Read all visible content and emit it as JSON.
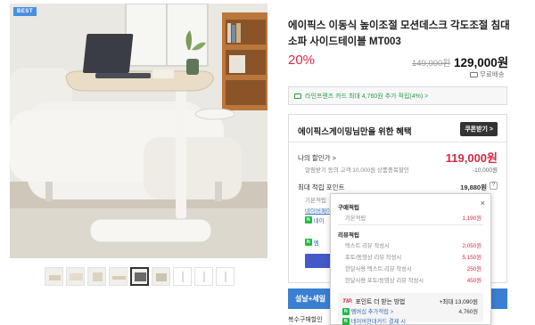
{
  "product": {
    "badge": "BEST",
    "title": "에이픽스 이동식 높이조절 모션데스크 각도조절 침대소파 사이드테이블 MT003",
    "discount": "20%",
    "original_price": "149,000원",
    "price": "129,000원",
    "shipping": "무료배송"
  },
  "thumbnails": {
    "count": 10,
    "active_index": 5
  },
  "card_promo": {
    "text": "라인프렌즈 카드 최대 4,760원 추가 적립(4%) >"
  },
  "benefits": {
    "heading": "에이픽스게이밍님만을 위한 혜택",
    "coupon_button": "쿠폰받기 >",
    "my_price_label": "나의 할인가 >",
    "my_price": "119,000원",
    "my_price_note": "알림받기 동의 고객 10,000원 상품중복할인",
    "my_price_discount": "-10,000원",
    "max_points_label": "최대 적립 포인트",
    "max_points": "19,880원",
    "help": "?",
    "basic_label": "기본적립",
    "link_partial": "네이버페이 포인트",
    "n_badge": "N",
    "n_row_partial": "네이",
    "n_row2_partial": "멤"
  },
  "popup": {
    "close": "×",
    "purchase_section": "구매적립",
    "basic_label": "기본적립",
    "basic_value": "1,190원",
    "review_section": "리뷰적립",
    "reviews": [
      {
        "label": "텍스트 리뷰 작성시",
        "value": "2,050원"
      },
      {
        "label": "포토/동영상 리뷰 작성시",
        "value": "5,150원"
      },
      {
        "label": "한달사용 텍스트 리뷰 작성시",
        "value": "250원"
      },
      {
        "label": "한달사용 포토/동영상 리뷰 작성시",
        "value": "450원"
      }
    ],
    "tip_badge": "TIP.",
    "tip_title": "포인트 더 받는 방법",
    "tip_total": "+최대 13,090원",
    "tip_items": [
      {
        "badge": "N",
        "label": "멤버십 추가적립 >",
        "value": "4,760원"
      },
      {
        "badge": "N",
        "label": "네이버현대카드 결제 시",
        "value": ""
      }
    ]
  },
  "bottom": {
    "blue_button_partial": "설날+세일",
    "multi_buy": "복수구매할인"
  }
}
